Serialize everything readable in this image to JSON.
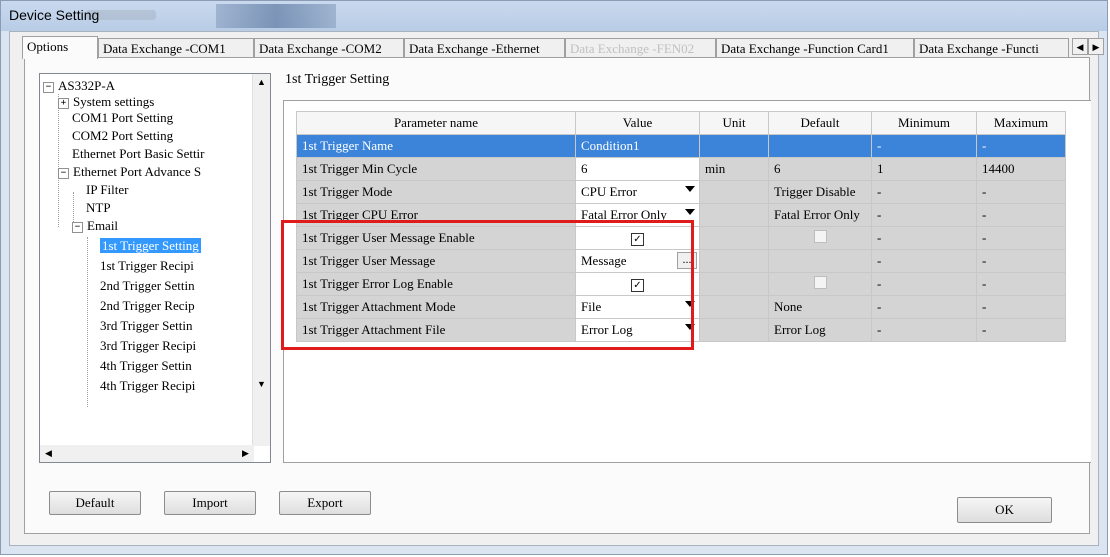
{
  "window": {
    "title": "Device Setting"
  },
  "tabs": [
    {
      "label": "Options",
      "state": "active"
    },
    {
      "label": "Data Exchange -COM1",
      "state": "normal"
    },
    {
      "label": "Data Exchange -COM2",
      "state": "normal"
    },
    {
      "label": "Data Exchange -Ethernet",
      "state": "normal"
    },
    {
      "label": "Data Exchange -FEN02",
      "state": "disabled"
    },
    {
      "label": "Data Exchange -Function Card1",
      "state": "normal"
    },
    {
      "label": "Data Exchange -Functi",
      "state": "normal"
    }
  ],
  "tree": {
    "root": "AS332P-A",
    "items": [
      {
        "label": "System settings"
      },
      {
        "label": "COM1 Port Setting"
      },
      {
        "label": "COM2 Port Setting"
      },
      {
        "label": "Ethernet Port Basic Settir"
      },
      {
        "label": "Ethernet Port Advance S"
      },
      {
        "label": "IP Filter"
      },
      {
        "label": "NTP"
      },
      {
        "label": "Email"
      },
      {
        "label": "1st Trigger Setting"
      },
      {
        "label": "1st Trigger Recipi"
      },
      {
        "label": "2nd Trigger Settin"
      },
      {
        "label": "2nd Trigger Recip"
      },
      {
        "label": "3rd Trigger Settin"
      },
      {
        "label": "3rd Trigger Recipi"
      },
      {
        "label": "4th Trigger Settin"
      },
      {
        "label": "4th Trigger Recipi"
      }
    ],
    "expander_minus": "−",
    "expander_plus": "+"
  },
  "section": {
    "title": "1st Trigger Setting"
  },
  "grid": {
    "headers": {
      "name": "Parameter name",
      "value": "Value",
      "unit": "Unit",
      "default": "Default",
      "minimum": "Minimum",
      "maximum": "Maximum"
    },
    "rows": [
      {
        "name": "1st Trigger Name",
        "value": "Condition1",
        "unit": "",
        "default": "",
        "minimum": "-",
        "maximum": "-"
      },
      {
        "name": "1st Trigger Min Cycle",
        "value": "6",
        "unit": "min",
        "default": "6",
        "minimum": "1",
        "maximum": "14400"
      },
      {
        "name": "1st Trigger Mode",
        "value": "CPU Error",
        "unit": "",
        "default": "Trigger Disable",
        "minimum": "-",
        "maximum": "-"
      },
      {
        "name": "1st Trigger CPU Error",
        "value": "Fatal Error Only",
        "unit": "",
        "default": "Fatal Error Only",
        "minimum": "-",
        "maximum": "-"
      },
      {
        "name": "1st Trigger User Message Enable",
        "value": "",
        "unit": "",
        "default": "",
        "minimum": "-",
        "maximum": "-"
      },
      {
        "name": "1st Trigger User Message",
        "value": "Message",
        "unit": "",
        "default": "",
        "minimum": "-",
        "maximum": "-"
      },
      {
        "name": "1st Trigger Error Log Enable",
        "value": "",
        "unit": "",
        "default": "",
        "minimum": "-",
        "maximum": "-"
      },
      {
        "name": "1st Trigger Attachment Mode",
        "value": "File",
        "unit": "",
        "default": "None",
        "minimum": "-",
        "maximum": "-"
      },
      {
        "name": "1st Trigger Attachment File",
        "value": "Error Log",
        "unit": "",
        "default": "Error Log",
        "minimum": "-",
        "maximum": "-"
      }
    ],
    "ellipsis": "..."
  },
  "buttons": {
    "default": "Default",
    "import": "Import",
    "export": "Export",
    "ok": "OK"
  },
  "colors": {
    "selection": "#3c84da",
    "highlight_box": "#e01b1b",
    "readonly_cell": "#d4d4d4"
  }
}
